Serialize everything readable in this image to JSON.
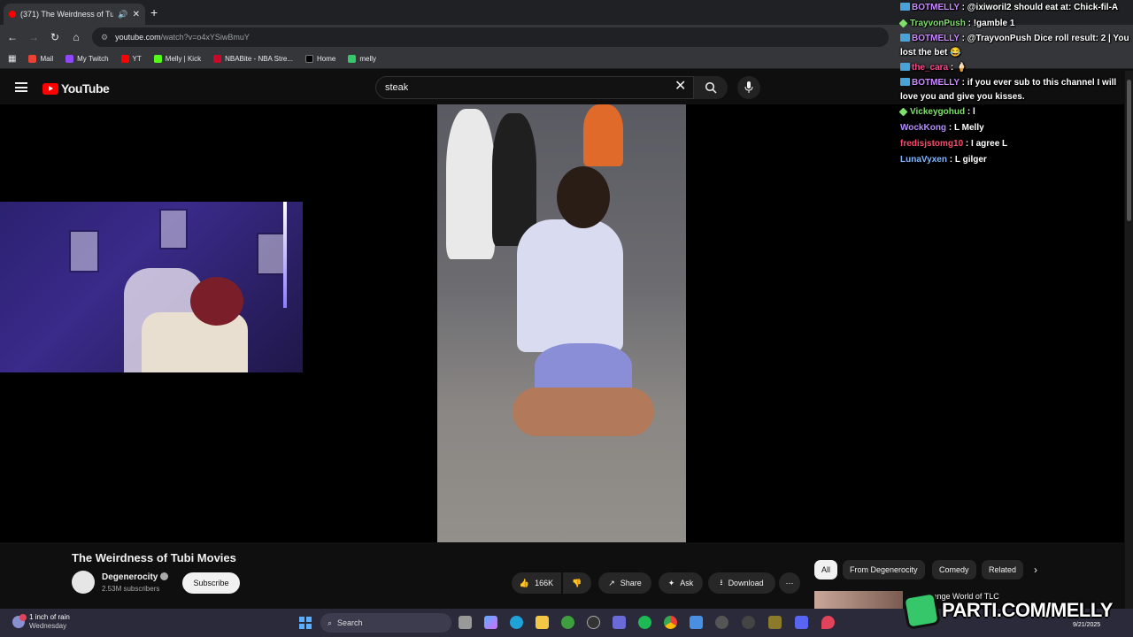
{
  "browser": {
    "tab_title": "(371) The Weirdness of Tubi",
    "url_host": "youtube.com",
    "url_path": "/watch?v=o4xYSiwBmuY",
    "bookmarks": [
      "Mail",
      "My Twitch",
      "YT",
      "Melly | Kick",
      "NBABite - NBA Stre...",
      "Home",
      "melly"
    ]
  },
  "youtube": {
    "logo_text": "YouTube",
    "search_query": "steak"
  },
  "video": {
    "title": "The Weirdness of Tubi Movies",
    "channel": "Degenerocity",
    "subscribers": "2.53M subscribers",
    "subscribe_label": "Subscribe",
    "likes": "166K",
    "share_label": "Share",
    "ask_label": "Ask",
    "download_label": "Download"
  },
  "chips": [
    "All",
    "From Degenerocity",
    "Comedy",
    "Related"
  ],
  "recommendation": {
    "title": "Strange World of TLC"
  },
  "chat": [
    {
      "user": "BOTMELLY",
      "color": "#c98bff",
      "badge": "bot",
      "text": "@ixiworil2 should eat at: Chick-fil-A"
    },
    {
      "user": "TrayvonPush",
      "color": "#7ee06a",
      "badge": "diamond",
      "text": "!gamble 1"
    },
    {
      "user": "BOTMELLY",
      "color": "#c98bff",
      "badge": "bot",
      "text": "@TrayvonPush Dice roll result: 2 | You lost the bet 😂"
    },
    {
      "user": "the_cara",
      "color": "#ff4a8d",
      "badge": "bot",
      "text": "🍦"
    },
    {
      "user": "BOTMELLY",
      "color": "#c98bff",
      "badge": "bot",
      "text": "if you ever sub to this channel I will love you and give you kisses."
    },
    {
      "user": "Vickeygohud",
      "color": "#7ee06a",
      "badge": "diamond",
      "text": "l"
    },
    {
      "user": "WockKong",
      "color": "#b48cff",
      "badge": "none",
      "text": "L Melly"
    },
    {
      "user": "fredisjstomg10",
      "color": "#ff4a6a",
      "badge": "none",
      "text": "I agree L"
    },
    {
      "user": "LunaVyxen",
      "color": "#7fb6ff",
      "badge": "none",
      "text": "L gilger"
    }
  ],
  "taskbar": {
    "weather_line1": "1 inch of rain",
    "weather_line2": "Wednesday",
    "search_label": "Search",
    "date": "9/21/2025"
  },
  "watermark": {
    "text": "PARTI.COM/MELLY"
  },
  "colors": {
    "youtube_red": "#ff0000",
    "parti_green": "#35c76a"
  }
}
